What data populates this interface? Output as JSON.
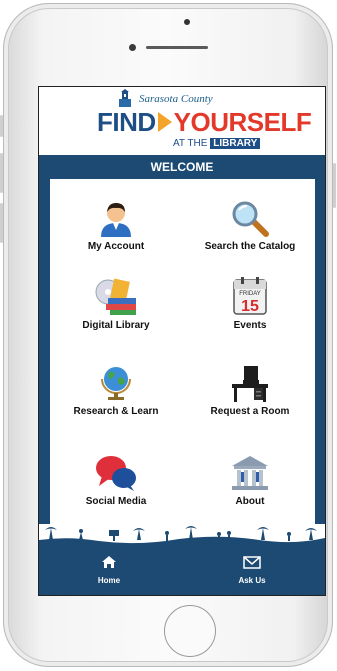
{
  "logo": {
    "county": "Sarasota County",
    "find": "FIND",
    "yourself": "YOURSELF",
    "at_the": "AT THE",
    "library": "LIBRARY"
  },
  "welcome": "WELCOME",
  "tiles": [
    {
      "label": "My Account",
      "icon": "person-icon"
    },
    {
      "label": "Search the Catalog",
      "icon": "magnifier-icon"
    },
    {
      "label": "Digital Library",
      "icon": "books-disc-icon"
    },
    {
      "label": "Events",
      "icon": "calendar-icon"
    },
    {
      "label": "Research & Learn",
      "icon": "globe-icon"
    },
    {
      "label": "Request a Room",
      "icon": "desk-chair-icon"
    },
    {
      "label": "Social Media",
      "icon": "speech-bubbles-icon"
    },
    {
      "label": "About",
      "icon": "library-building-icon"
    }
  ],
  "calendar": {
    "day": "FRIDAY",
    "date": "15"
  },
  "tabs": [
    {
      "label": "Home",
      "icon": "home-icon"
    },
    {
      "label": "Ask Us",
      "icon": "envelope-icon"
    }
  ],
  "colors": {
    "navy": "#1c4a73",
    "logo_blue": "#1e4e86",
    "logo_red": "#e2392a",
    "logo_orange": "#f2a52a"
  }
}
